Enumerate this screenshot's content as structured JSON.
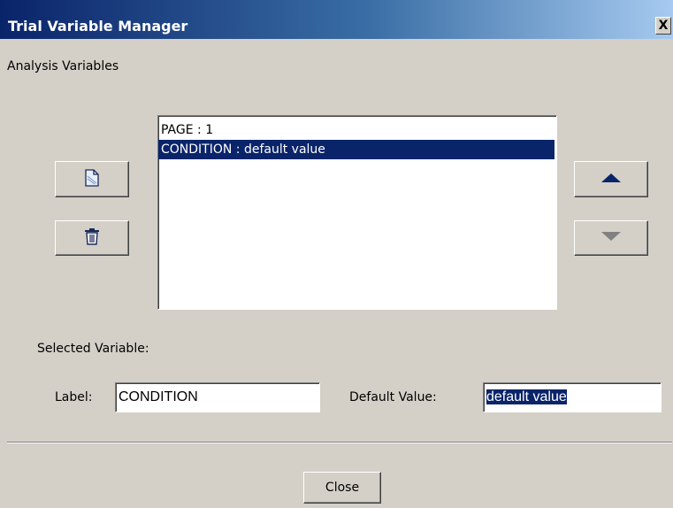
{
  "window": {
    "title": "Trial Variable Manager",
    "close_glyph": "X"
  },
  "analysis": {
    "heading": "Analysis Variables",
    "variables": [
      {
        "text": "PAGE : 1",
        "selected": false
      },
      {
        "text": "CONDITION : default value",
        "selected": true
      }
    ]
  },
  "toolbar": {
    "new_icon": "new-document-icon",
    "delete_icon": "trash-icon",
    "move_up_icon": "arrow-up-icon",
    "move_down_icon": "arrow-down-icon",
    "move_down_enabled": false
  },
  "selected": {
    "heading": "Selected Variable:",
    "label_caption": "Label:",
    "label_value": "CONDITION",
    "default_caption": "Default Value:",
    "default_value": "default value"
  },
  "footer": {
    "close_label": "Close"
  },
  "colors": {
    "selection": "#0a246a",
    "dialog_bg": "#d4d0c8",
    "enabled_arrow": "#0a246a",
    "disabled_arrow": "#808080"
  }
}
